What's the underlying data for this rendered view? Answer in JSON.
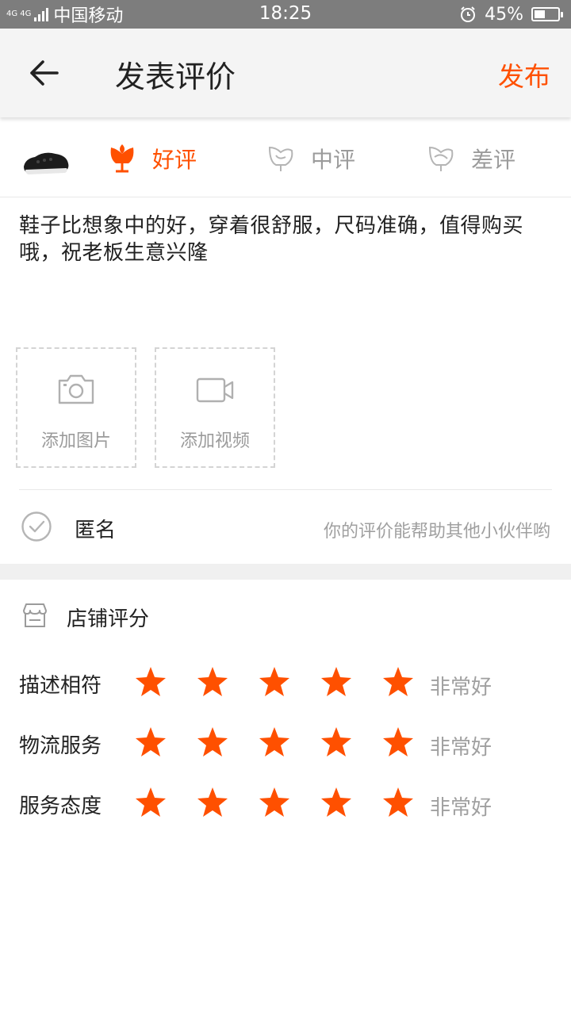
{
  "status_bar": {
    "network": "4G 4G",
    "carrier": "中国移动",
    "time": "18:25",
    "battery": "45%",
    "battery_level": 0.45
  },
  "header": {
    "title": "发表评价",
    "publish_label": "发布"
  },
  "rating": {
    "good": "好评",
    "mid": "中评",
    "bad": "差评",
    "selected": "good"
  },
  "review_text": "鞋子比想象中的好，穿着很舒服，尺码准确，值得购买哦，祝老板生意兴隆",
  "media": {
    "add_photo": "添加图片",
    "add_video": "添加视频"
  },
  "anonymous": {
    "label": "匿名",
    "hint": "你的评价能帮助其他小伙伴哟"
  },
  "shop_rating": {
    "title": "店铺评分",
    "rows": [
      {
        "label": "描述相符",
        "stars": 5,
        "text": "非常好"
      },
      {
        "label": "物流服务",
        "stars": 5,
        "text": "非常好"
      },
      {
        "label": "服务态度",
        "stars": 5,
        "text": "非常好"
      }
    ]
  },
  "colors": {
    "accent": "#ff5000",
    "muted": "#9b9b9b",
    "status_bar": "#7d7d7d"
  }
}
